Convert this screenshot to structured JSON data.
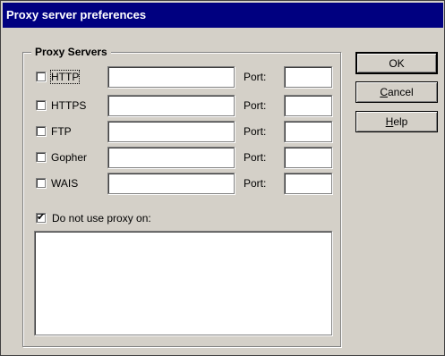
{
  "window": {
    "title": "Proxy server preferences"
  },
  "proxy_servers": {
    "group_label": "Proxy Servers",
    "port_label": "Port:",
    "protocols": [
      {
        "label": "HTTP",
        "checked": false,
        "host": "",
        "port": ""
      },
      {
        "label": "HTTPS",
        "checked": false,
        "host": "",
        "port": ""
      },
      {
        "label": "FTP",
        "checked": false,
        "host": "",
        "port": ""
      },
      {
        "label": "Gopher",
        "checked": false,
        "host": "",
        "port": ""
      },
      {
        "label": "WAIS",
        "checked": false,
        "host": "",
        "port": ""
      }
    ],
    "no_proxy": {
      "label": "Do not use proxy on:",
      "checked": true,
      "value": ""
    }
  },
  "buttons": {
    "ok": "OK",
    "cancel": {
      "mnemonic": "C",
      "rest": "ancel"
    },
    "help": {
      "mnemonic": "H",
      "rest": "elp"
    }
  }
}
